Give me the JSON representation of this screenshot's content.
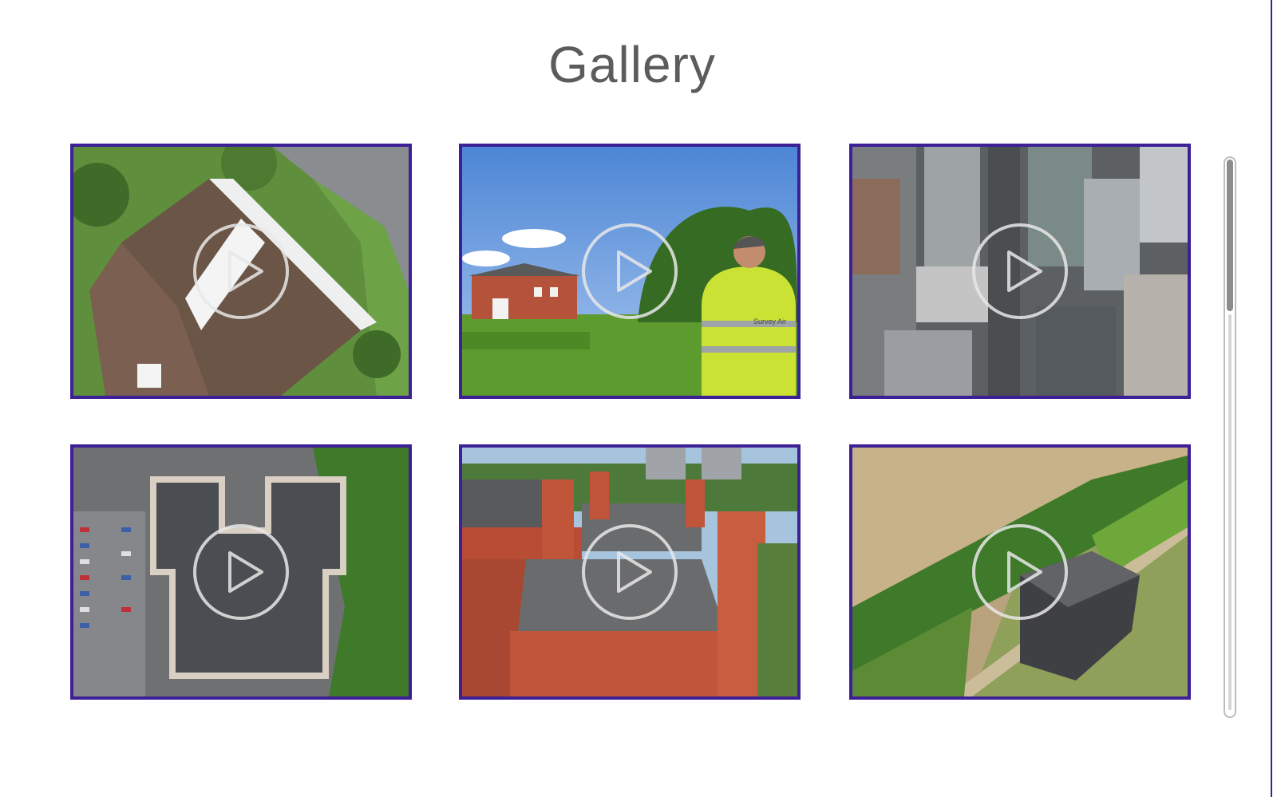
{
  "page": {
    "title": "Gallery",
    "accent_color": "#3d1f96"
  },
  "gallery": {
    "items": [
      {
        "subject": "aerial view of house roof",
        "icon": "play-icon"
      },
      {
        "subject": "drone pilot in hi-vis vest with country house",
        "icon": "play-icon",
        "vest_text": "Survey Air"
      },
      {
        "subject": "top-down view of city skyscrapers",
        "icon": "play-icon"
      },
      {
        "subject": "top-down view of flat-roofed building and car park",
        "icon": "play-icon"
      },
      {
        "subject": "red brick building roofs and chimneys",
        "icon": "play-icon"
      },
      {
        "subject": "brick barn beside wheat field",
        "icon": "play-icon"
      }
    ]
  }
}
